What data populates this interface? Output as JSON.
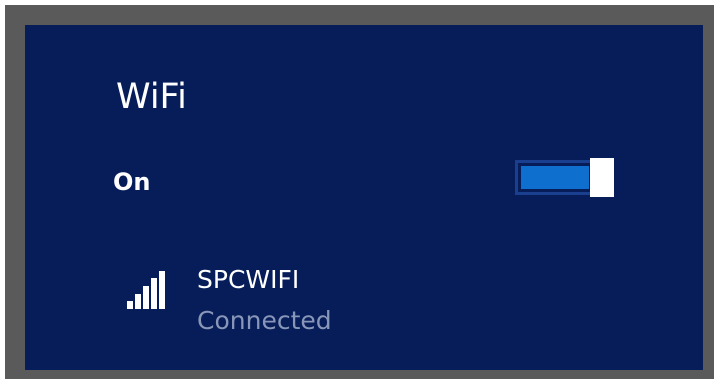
{
  "wifi_panel": {
    "title": "WiFi",
    "toggle": {
      "label": "On",
      "state": "on",
      "accent_color": "#0e6fcf"
    },
    "network": {
      "name": "SPCWIFI",
      "status": "Connected",
      "icon": "signal-strength-icon",
      "signal_bars": 5
    },
    "background_color": "#061d5a"
  }
}
